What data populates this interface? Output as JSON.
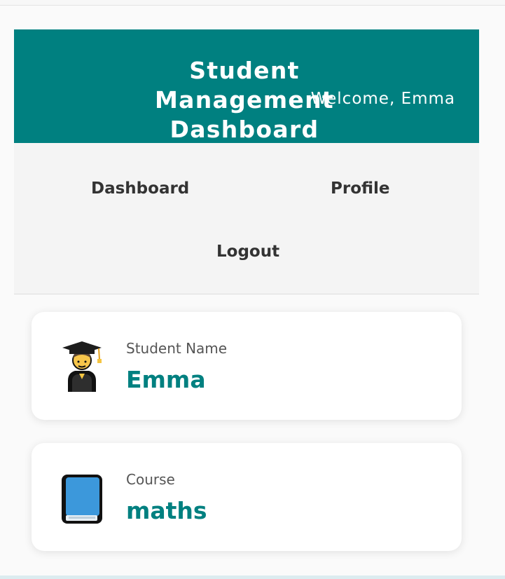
{
  "header": {
    "title": "Student Management Dashboard",
    "welcome": "Welcome, Emma"
  },
  "nav": {
    "items": [
      "Dashboard",
      "Profile",
      "Logout"
    ]
  },
  "cards": [
    {
      "label": "Student Name",
      "value": "Emma",
      "icon": "graduate-icon"
    },
    {
      "label": "Course",
      "value": "maths",
      "icon": "book-icon"
    }
  ],
  "colors": {
    "primary": "#008080",
    "nav_background": "#f4f4f4",
    "card_background": "#ffffff"
  }
}
